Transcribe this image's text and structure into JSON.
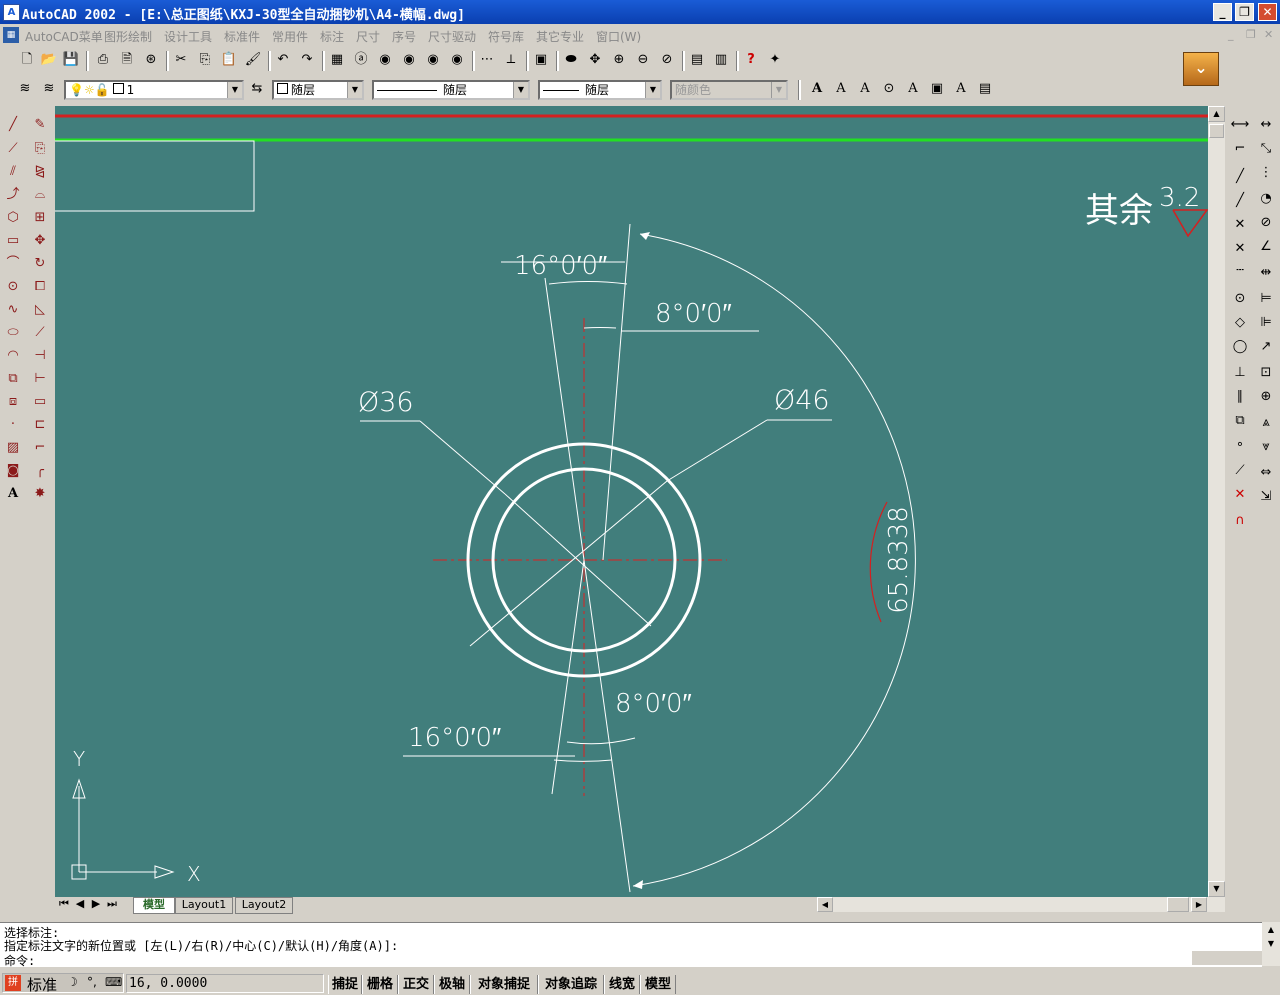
{
  "window": {
    "title": "AutoCAD 2002 - [E:\\总正图纸\\KXJ-30型全自动捆钞机\\A4-横幅.dwg]",
    "minimize": "_",
    "restore": "❐",
    "close": "✕"
  },
  "menubar": {
    "items": [
      "AutoCAD菜单",
      "图形绘制",
      "设计工具",
      "标准件",
      "常用件",
      "标注",
      "尺寸",
      "序号",
      "尺寸驱动",
      "符号库",
      "其它专业",
      "窗口(W)"
    ]
  },
  "properties_bar": {
    "layer": "1",
    "color": "随层",
    "linetype": "随层",
    "lineweight": "随层",
    "plotstyle": "随颜色"
  },
  "drawing": {
    "roughness_prefix": "其余",
    "roughness_value": "3.2",
    "dim_angle_top_outer": "16°0′0″",
    "dim_angle_top_inner": "8°0′0″",
    "dim_angle_bottom_inner": "8°0′0″",
    "dim_angle_bottom_outer": "16°0′0″",
    "dia_inner": "Ø36",
    "dia_outer": "Ø46",
    "arc_length": "65.8338",
    "ucs_y": "Y",
    "ucs_x": "X",
    "colors": {
      "background": "#417e7c",
      "red_line": "#d42020",
      "green_line": "#22e022",
      "center_line": "#e02020",
      "geometry": "#ffffff"
    }
  },
  "layout_tabs": [
    "模型",
    "Layout1",
    "Layout2"
  ],
  "command_line": {
    "line1": "选择标注:",
    "line2": "指定标注文字的新位置或 [左(L)/右(R)/中心(C)/默认(H)/角度(A)]:",
    "line3": "命令:"
  },
  "status_bar": {
    "ime_mode": "标准",
    "coords": "16, 0.0000",
    "toggles": [
      "捕捉",
      "栅格",
      "正交",
      "极轴",
      "对象捕捉",
      "对象追踪",
      "线宽",
      "模型"
    ]
  }
}
